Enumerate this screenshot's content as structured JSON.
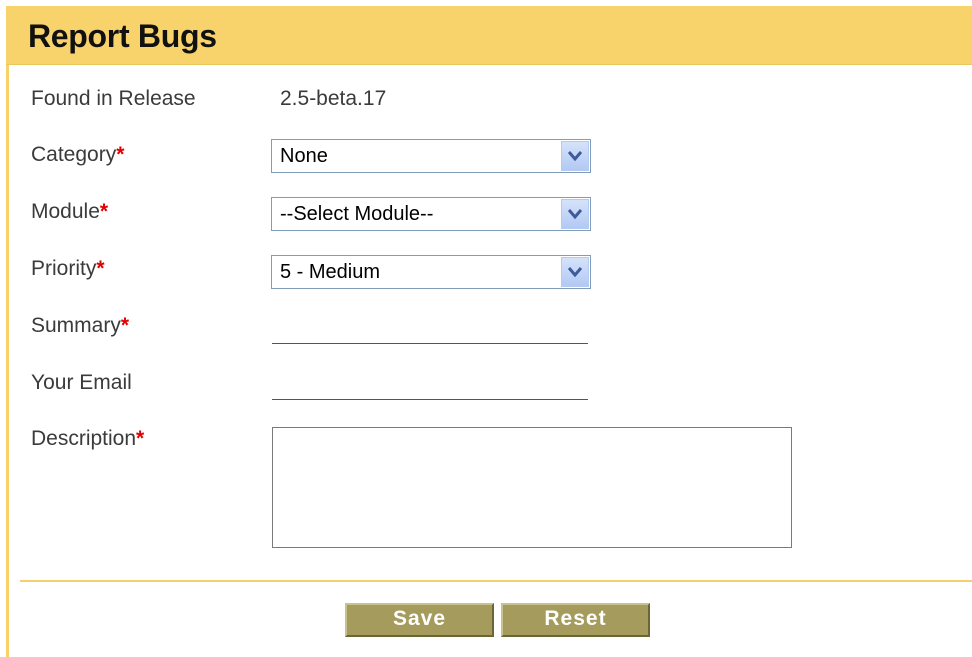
{
  "header": {
    "title": "Report Bugs"
  },
  "form": {
    "release": {
      "label": "Found in Release",
      "value": "2.5-beta.17"
    },
    "category": {
      "label": "Category",
      "required_mark": "*",
      "selected": "None"
    },
    "module": {
      "label": "Module",
      "required_mark": "*",
      "selected": "--Select Module--"
    },
    "priority": {
      "label": "Priority",
      "required_mark": "*",
      "selected": "5 - Medium"
    },
    "summary": {
      "label": "Summary",
      "required_mark": "*",
      "value": ""
    },
    "email": {
      "label": "Your Email",
      "value": ""
    },
    "description": {
      "label": "Description",
      "required_mark": "*",
      "value": ""
    }
  },
  "actions": {
    "save_label": "Save",
    "reset_label": "Reset"
  },
  "colors": {
    "header_bg": "#f8d26b",
    "required_mark": "#e00000",
    "button_bg": "#a49b5d",
    "select_button": "#c3d3f6"
  },
  "icons": {
    "dropdown": "chevron-down-icon"
  }
}
